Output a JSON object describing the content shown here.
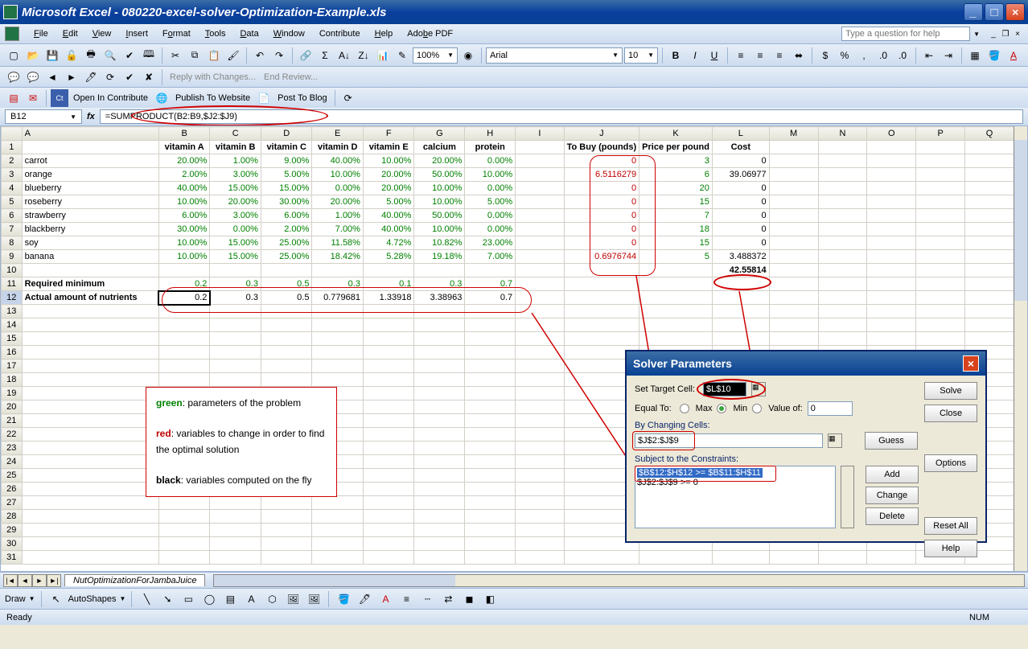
{
  "titlebar": {
    "title": "Microsoft Excel - 080220-excel-solver-Optimization-Example.xls"
  },
  "menu": {
    "file": "File",
    "edit": "Edit",
    "view": "View",
    "insert": "Insert",
    "format": "Format",
    "tools": "Tools",
    "data": "Data",
    "window": "Window",
    "contribute": "Contribute",
    "help": "Help",
    "adobe": "Adobe PDF"
  },
  "help_placeholder": "Type a question for help",
  "toolbar": {
    "zoom": "100%",
    "font": "Arial",
    "size": "10",
    "reply": "Reply with Changes...",
    "end_review": "End Review...",
    "open_contribute": "Open In Contribute",
    "publish": "Publish To Website",
    "post_blog": "Post To Blog"
  },
  "formula": {
    "name_box": "B12",
    "formula": "=SUMPRODUCT(B2:B9,$J2:$J9)"
  },
  "columns": [
    "",
    "A",
    "B",
    "C",
    "D",
    "E",
    "F",
    "G",
    "H",
    "I",
    "J",
    "K",
    "L",
    "M",
    "N",
    "O",
    "P",
    "Q"
  ],
  "headers": {
    "vitA": "vitamin A",
    "vitB": "vitamin B",
    "vitC": "vitamin C",
    "vitD": "vitamin D",
    "vitE": "vitamin E",
    "cal": "calcium",
    "prot": "protein",
    "tobuy": "To Buy (pounds)",
    "price": "Price per pound",
    "cost": "Cost"
  },
  "rows": [
    {
      "name": "carrot",
      "v": [
        "20.00%",
        "1.00%",
        "9.00%",
        "40.00%",
        "10.00%",
        "20.00%",
        "0.00%"
      ],
      "buy": "0",
      "price": "3",
      "cost": "0"
    },
    {
      "name": "orange",
      "v": [
        "2.00%",
        "3.00%",
        "5.00%",
        "10.00%",
        "20.00%",
        "50.00%",
        "10.00%"
      ],
      "buy": "6.5116279",
      "price": "6",
      "cost": "39.06977"
    },
    {
      "name": "blueberry",
      "v": [
        "40.00%",
        "15.00%",
        "15.00%",
        "0.00%",
        "20.00%",
        "10.00%",
        "0.00%"
      ],
      "buy": "0",
      "price": "20",
      "cost": "0"
    },
    {
      "name": "roseberry",
      "v": [
        "10.00%",
        "20.00%",
        "30.00%",
        "20.00%",
        "5.00%",
        "10.00%",
        "5.00%"
      ],
      "buy": "0",
      "price": "15",
      "cost": "0"
    },
    {
      "name": "strawberry",
      "v": [
        "6.00%",
        "3.00%",
        "6.00%",
        "1.00%",
        "40.00%",
        "50.00%",
        "0.00%"
      ],
      "buy": "0",
      "price": "7",
      "cost": "0"
    },
    {
      "name": "blackberry",
      "v": [
        "30.00%",
        "0.00%",
        "2.00%",
        "7.00%",
        "40.00%",
        "10.00%",
        "0.00%"
      ],
      "buy": "0",
      "price": "18",
      "cost": "0"
    },
    {
      "name": "soy",
      "v": [
        "10.00%",
        "15.00%",
        "25.00%",
        "11.58%",
        "4.72%",
        "10.82%",
        "23.00%"
      ],
      "buy": "0",
      "price": "15",
      "cost": "0"
    },
    {
      "name": "banana",
      "v": [
        "10.00%",
        "15.00%",
        "25.00%",
        "18.42%",
        "5.28%",
        "19.18%",
        "7.00%"
      ],
      "buy": "0.6976744",
      "price": "5",
      "cost": "3.488372"
    }
  ],
  "total_cost": "42.55814",
  "required": {
    "label": "Required minimum",
    "v": [
      "0.2",
      "0.3",
      "0.5",
      "0.3",
      "0.1",
      "0.3",
      "0.7"
    ]
  },
  "actual": {
    "label": "Actual amount of nutrients",
    "v": [
      "0.2",
      "0.3",
      "0.5",
      "0.779681",
      "1.33918",
      "3.38963",
      "0.7"
    ]
  },
  "legend": {
    "green": "green",
    "green_txt": ": parameters of the problem",
    "red": "red",
    "red_txt": ": variables to change in order to find the optimal solution",
    "black": "black",
    "black_txt": ": variables computed on the fly"
  },
  "solver": {
    "title": "Solver Parameters",
    "set_target": "Set Target Cell:",
    "target_val": "$L$10",
    "equal_to": "Equal To:",
    "max": "Max",
    "min": "Min",
    "valueof": "Value of:",
    "valueof_val": "0",
    "by_changing": "By Changing Cells:",
    "changing_val": "$J$2:$J$9",
    "subject": "Subject to the Constraints:",
    "c1": "$B$12:$H$12 >= $B$11:$H$11",
    "c2": "$J$2:$J$9 >= 0",
    "solve": "Solve",
    "close": "Close",
    "guess": "Guess",
    "options": "Options",
    "add": "Add",
    "change": "Change",
    "delete": "Delete",
    "reset": "Reset All",
    "help": "Help"
  },
  "sheet_tab": "NutOptimizationForJambaJuice",
  "draw": {
    "label": "Draw",
    "autoshapes": "AutoShapes"
  },
  "status": {
    "ready": "Ready",
    "num": "NUM"
  }
}
